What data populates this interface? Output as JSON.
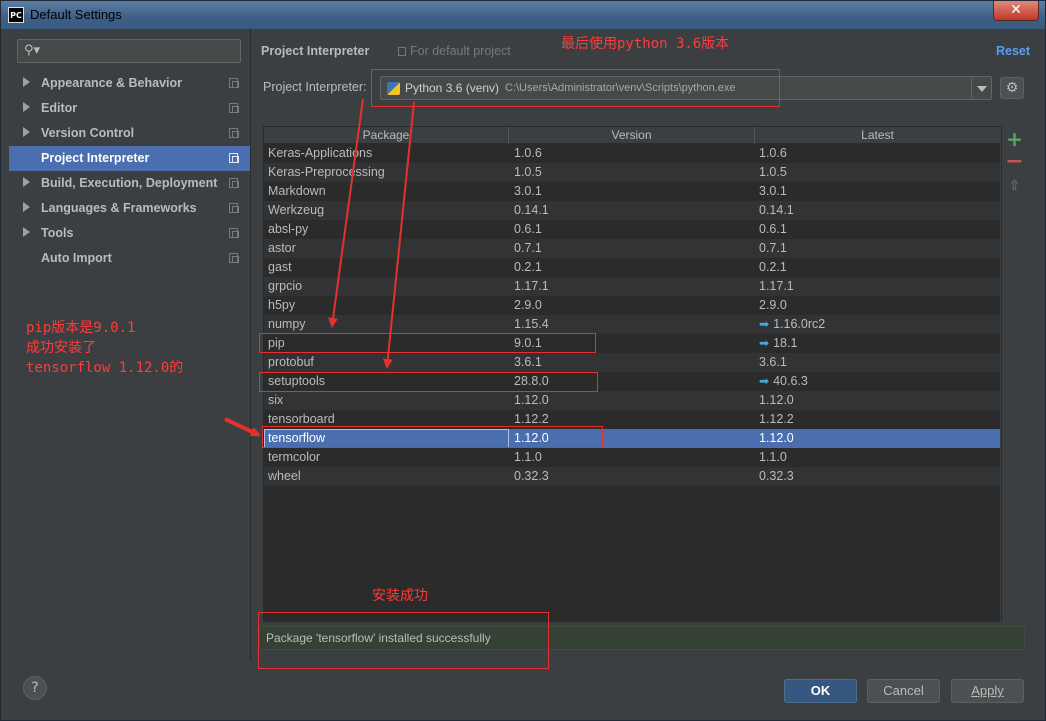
{
  "window": {
    "title": "Default Settings",
    "app_icon": "PC",
    "close_icon": "close-icon"
  },
  "sidebar": {
    "search_placeholder": "",
    "items": [
      {
        "label": "Appearance & Behavior",
        "expandable": true
      },
      {
        "label": "Editor",
        "expandable": true
      },
      {
        "label": "Version Control",
        "expandable": true
      },
      {
        "label": "Project Interpreter",
        "expandable": false,
        "active": true
      },
      {
        "label": "Build, Execution, Deployment",
        "expandable": true
      },
      {
        "label": "Languages & Frameworks",
        "expandable": true
      },
      {
        "label": "Tools",
        "expandable": true
      },
      {
        "label": "Auto Import",
        "expandable": false
      }
    ]
  },
  "header": {
    "breadcrumb": "Project Interpreter",
    "scope": "For default project",
    "reset": "Reset"
  },
  "interpreter": {
    "label": "Project Interpreter:",
    "name": "Python 3.6 (venv)",
    "path": "C:\\Users\\Administrator\\venv\\Scripts\\python.exe"
  },
  "table": {
    "columns": [
      "Package",
      "Version",
      "Latest"
    ],
    "rows": [
      {
        "package": "Keras-Applications",
        "version": "1.0.6",
        "latest": "1.0.6",
        "upgrade": false
      },
      {
        "package": "Keras-Preprocessing",
        "version": "1.0.5",
        "latest": "1.0.5",
        "upgrade": false
      },
      {
        "package": "Markdown",
        "version": "3.0.1",
        "latest": "3.0.1",
        "upgrade": false
      },
      {
        "package": "Werkzeug",
        "version": "0.14.1",
        "latest": "0.14.1",
        "upgrade": false
      },
      {
        "package": "absl-py",
        "version": "0.6.1",
        "latest": "0.6.1",
        "upgrade": false
      },
      {
        "package": "astor",
        "version": "0.7.1",
        "latest": "0.7.1",
        "upgrade": false
      },
      {
        "package": "gast",
        "version": "0.2.1",
        "latest": "0.2.1",
        "upgrade": false
      },
      {
        "package": "grpcio",
        "version": "1.17.1",
        "latest": "1.17.1",
        "upgrade": false
      },
      {
        "package": "h5py",
        "version": "2.9.0",
        "latest": "2.9.0",
        "upgrade": false
      },
      {
        "package": "numpy",
        "version": "1.15.4",
        "latest": "1.16.0rc2",
        "upgrade": true
      },
      {
        "package": "pip",
        "version": "9.0.1",
        "latest": "18.1",
        "upgrade": true
      },
      {
        "package": "protobuf",
        "version": "3.6.1",
        "latest": "3.6.1",
        "upgrade": false
      },
      {
        "package": "setuptools",
        "version": "28.8.0",
        "latest": "40.6.3",
        "upgrade": true
      },
      {
        "package": "six",
        "version": "1.12.0",
        "latest": "1.12.0",
        "upgrade": false
      },
      {
        "package": "tensorboard",
        "version": "1.12.2",
        "latest": "1.12.2",
        "upgrade": false
      },
      {
        "package": "tensorflow",
        "version": "1.12.0",
        "latest": "1.12.0",
        "upgrade": false,
        "selected": true
      },
      {
        "package": "termcolor",
        "version": "1.1.0",
        "latest": "1.1.0",
        "upgrade": false
      },
      {
        "package": "wheel",
        "version": "0.32.3",
        "latest": "0.32.3",
        "upgrade": false
      }
    ],
    "upgrade_glyph": "➡"
  },
  "side_tools": {
    "add": "+",
    "remove": "−",
    "upgrade": "⇧"
  },
  "status": "Package 'tensorflow' installed successfully",
  "footer": {
    "help": "?",
    "ok": "OK",
    "cancel": "Cancel",
    "apply": "Apply"
  },
  "annotations": {
    "top_note": "最后使用python 3.6版本",
    "left_note_line1": "pip版本是9.0.1",
    "left_note_line2": "成功安装了",
    "left_note_line3": "tensorflow 1.12.0的",
    "success_note": "安装成功",
    "color": "#e53030"
  }
}
